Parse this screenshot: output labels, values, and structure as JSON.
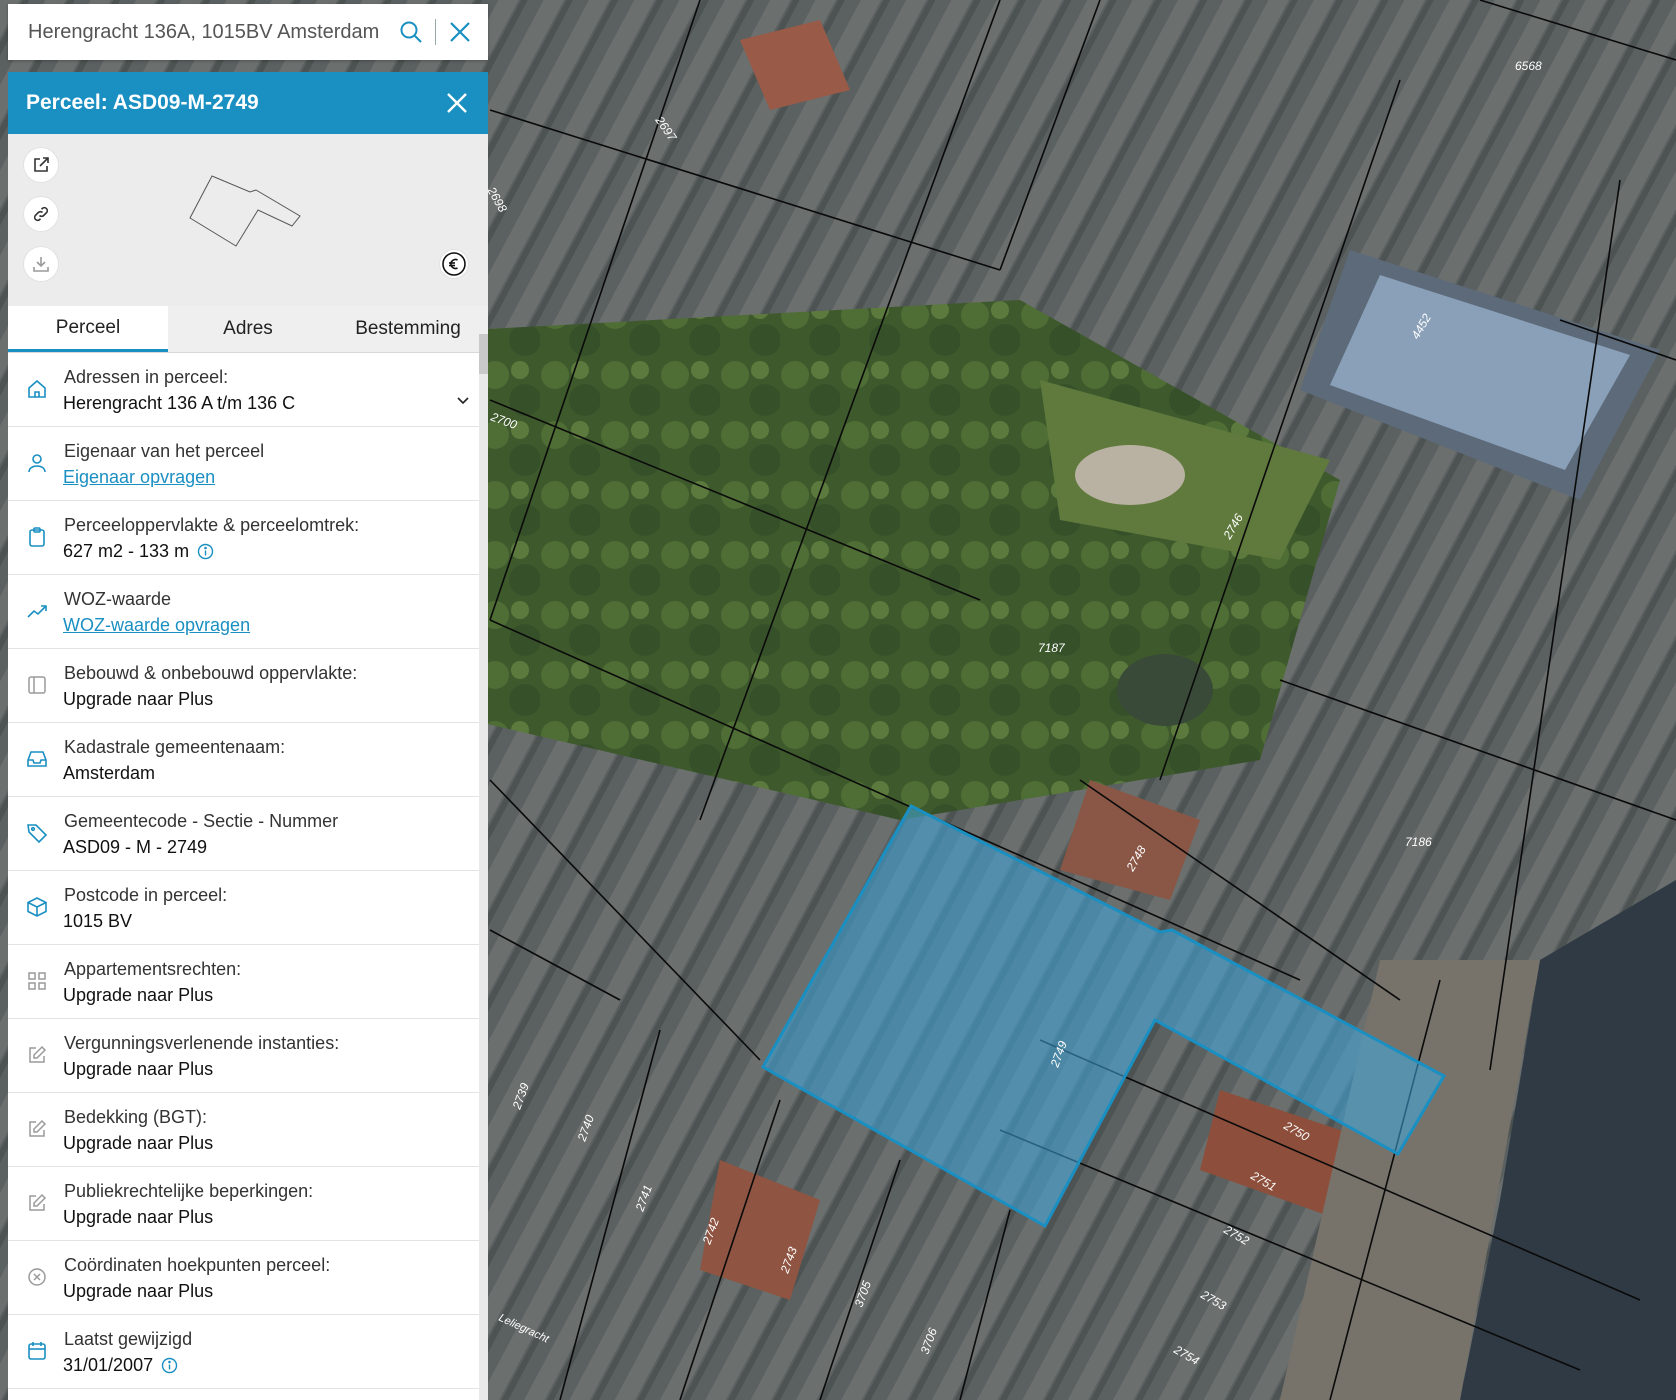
{
  "search": {
    "value": "Herengracht 136A, 1015BV Amsterdam"
  },
  "panel": {
    "title": "Perceel: ASD09-M-2749",
    "tabs": [
      {
        "label": "Perceel",
        "active": true
      },
      {
        "label": "Adres",
        "active": false
      },
      {
        "label": "Bestemming",
        "active": false
      }
    ],
    "rows": [
      {
        "icon": "home-icon",
        "label": "Adressen in perceel:",
        "value": "Herengracht 136 A t/m 136 C",
        "link": false,
        "dropdown": true
      },
      {
        "icon": "person-icon",
        "label": "Eigenaar van het perceel",
        "value": "Eigenaar opvragen",
        "link": true
      },
      {
        "icon": "clipboard-icon",
        "label": "Perceeloppervlakte & perceelomtrek:",
        "value": "627 m2 - 133 m",
        "link": false,
        "info": true
      },
      {
        "icon": "trend-icon",
        "label": "WOZ-waarde",
        "value": "WOZ-waarde opvragen",
        "link": true
      },
      {
        "icon": "layout-icon",
        "label": "Bebouwd & onbebouwd oppervlakte:",
        "value": "Upgrade naar Plus",
        "link": false
      },
      {
        "icon": "inbox-icon",
        "label": "Kadastrale gemeentenaam:",
        "value": "Amsterdam",
        "link": false
      },
      {
        "icon": "tag-icon",
        "label": "Gemeentecode - Sectie - Nummer",
        "value": "ASD09 - M - 2749",
        "link": false
      },
      {
        "icon": "box-icon",
        "label": "Postcode in perceel:",
        "value": "1015 BV",
        "link": false
      },
      {
        "icon": "grid-icon",
        "label": "Appartementsrechten:",
        "value": "Upgrade naar Plus",
        "link": false
      },
      {
        "icon": "edit-icon",
        "label": "Vergunningsverlenende instanties:",
        "value": "Upgrade naar Plus",
        "link": false
      },
      {
        "icon": "edit-icon",
        "label": "Bedekking (BGT):",
        "value": "Upgrade naar Plus",
        "link": false
      },
      {
        "icon": "edit-icon",
        "label": "Publiekrechtelijke beperkingen:",
        "value": "Upgrade naar Plus",
        "link": false
      },
      {
        "icon": "x-circle-icon",
        "label": "Coördinaten hoekpunten perceel:",
        "value": "Upgrade naar Plus",
        "link": false
      },
      {
        "icon": "calendar-icon",
        "label": "Laatst gewijzigd",
        "value": "31/01/2007",
        "link": false,
        "info": true
      }
    ]
  },
  "map": {
    "parcel_numbers": [
      "6568",
      "2697",
      "2698",
      "2700",
      "7187",
      "2746",
      "2748",
      "7186",
      "2749",
      "2750",
      "2751",
      "2752",
      "2753",
      "2754",
      "2739",
      "2740",
      "2741",
      "2742",
      "2743",
      "3705",
      "3706",
      "4452"
    ],
    "street_label": "Leliegracht",
    "selected_parcel": "2749",
    "highlight_color": "#1a8fc2"
  }
}
